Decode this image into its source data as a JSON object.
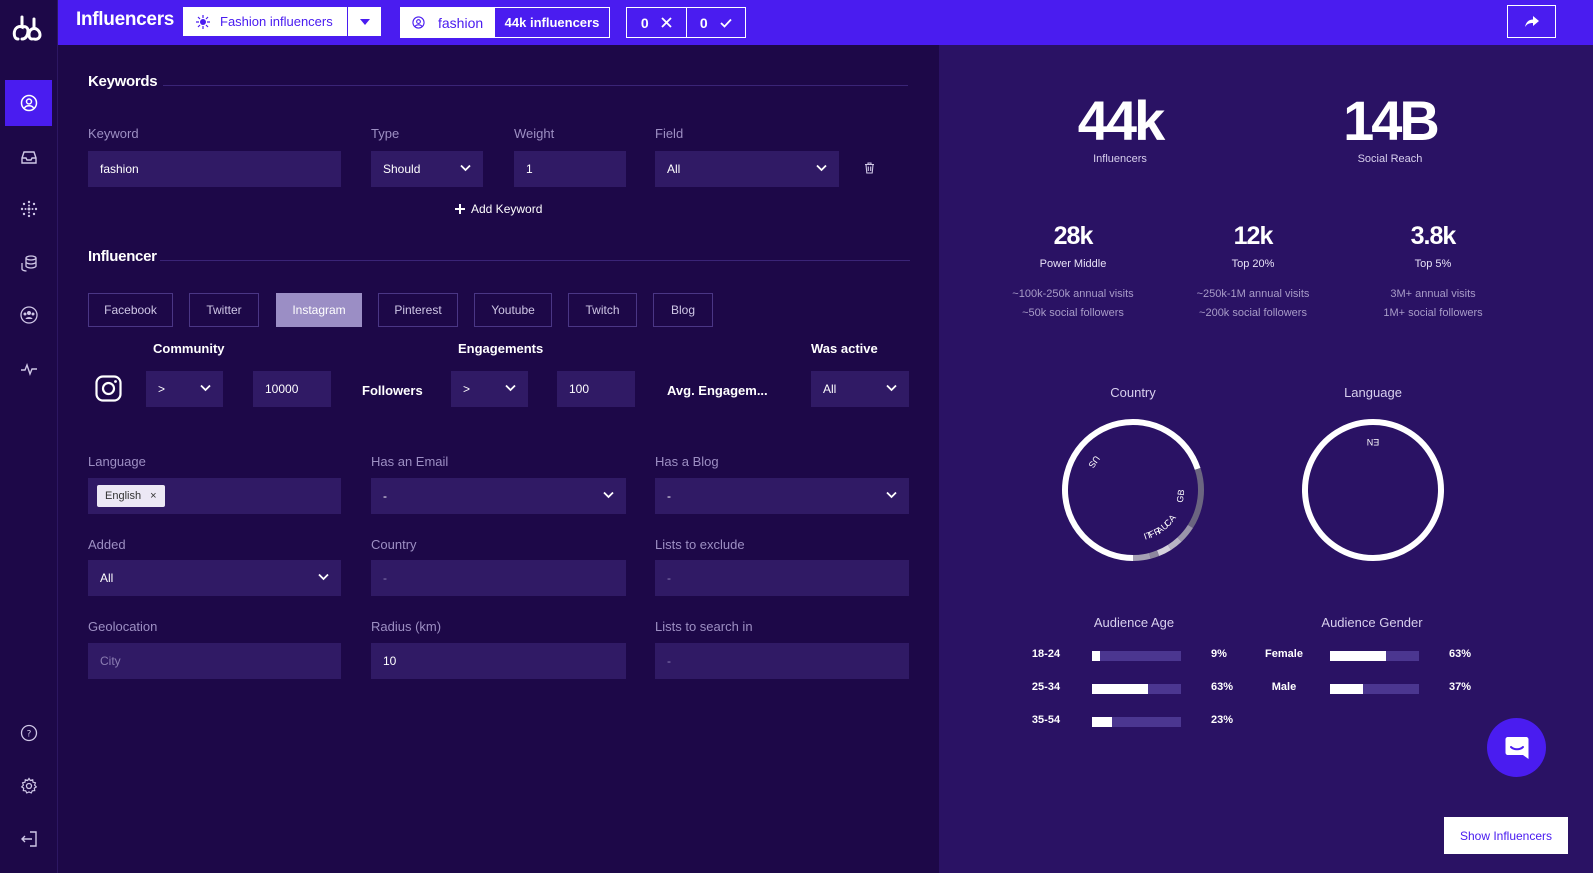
{
  "topbar": {
    "title": "Influencers",
    "search_name": "Fashion influencers",
    "keyword": "fashion",
    "result_count": "44k influencers",
    "rejected_count": "0",
    "accepted_count": "0"
  },
  "keywords_section": {
    "title": "Keywords",
    "labels": {
      "keyword": "Keyword",
      "type": "Type",
      "weight": "Weight",
      "field": "Field"
    },
    "row": {
      "keyword": "fashion",
      "type": "Should",
      "weight": "1",
      "field": "All"
    },
    "add_label": "Add Keyword"
  },
  "influencer_section": {
    "title": "Influencer",
    "networks": [
      "Facebook",
      "Twitter",
      "Instagram",
      "Pinterest",
      "Youtube",
      "Twitch",
      "Blog"
    ],
    "active_network": "Instagram",
    "community_head": "Community",
    "engagements_head": "Engagements",
    "was_active_head": "Was active",
    "community_op": ">",
    "community_value": "10000",
    "followers_label": "Followers",
    "engagement_op": ">",
    "engagement_value": "100",
    "engagement_label": "Avg. Engagem...",
    "was_active_value": "All"
  },
  "filters": {
    "language_label": "Language",
    "language_tag": "English",
    "has_email_label": "Has an Email",
    "has_email_value": "-",
    "has_blog_label": "Has a Blog",
    "has_blog_value": "-",
    "added_label": "Added",
    "added_value": "All",
    "country_label": "Country",
    "country_value": "-",
    "lists_exclude_label": "Lists to exclude",
    "lists_exclude_value": "-",
    "geolocation_label": "Geolocation",
    "geolocation_placeholder": "City",
    "radius_label": "Radius (km)",
    "radius_value": "10",
    "lists_search_label": "Lists to search in",
    "lists_search_value": "-"
  },
  "stats": {
    "influencers": {
      "value": "44k",
      "label": "Influencers"
    },
    "reach": {
      "value": "14B",
      "label": "Social Reach"
    },
    "tiers": [
      {
        "value": "28k",
        "label": "Power Middle",
        "line1": "~100k-250k annual visits",
        "line2": "~50k social followers"
      },
      {
        "value": "12k",
        "label": "Top 20%",
        "line1": "~250k-1M annual visits",
        "line2": "~200k social followers"
      },
      {
        "value": "3.8k",
        "label": "Top 5%",
        "line1": "3M+ annual visits",
        "line2": "1M+ social followers"
      }
    ]
  },
  "charts": {
    "country_title": "Country",
    "language_title": "Language",
    "audience_age_title": "Audience Age",
    "audience_gender_title": "Audience Gender"
  },
  "chart_data": [
    {
      "type": "pie",
      "title": "Country",
      "categories": [
        "US",
        "GB",
        "CA",
        "AU",
        "FR",
        "IT",
        "Other"
      ],
      "values": [
        70,
        14,
        4,
        3,
        3,
        2,
        4
      ]
    },
    {
      "type": "pie",
      "title": "Language",
      "categories": [
        "EN"
      ],
      "values": [
        100
      ]
    },
    {
      "type": "bar",
      "title": "Audience Age",
      "categories": [
        "18-24",
        "25-34",
        "35-54"
      ],
      "values": [
        9,
        63,
        23
      ],
      "value_labels": [
        "9%",
        "63%",
        "23%"
      ]
    },
    {
      "type": "bar",
      "title": "Audience Gender",
      "categories": [
        "Female",
        "Male"
      ],
      "values": [
        63,
        37
      ],
      "value_labels": [
        "63%",
        "37%"
      ]
    }
  ],
  "actions": {
    "show_label": "Show Influencers"
  },
  "colors": {
    "accent": "#4a1cf0",
    "background": "#1d0848",
    "panel": "#2a1264",
    "field": "#301a65"
  }
}
